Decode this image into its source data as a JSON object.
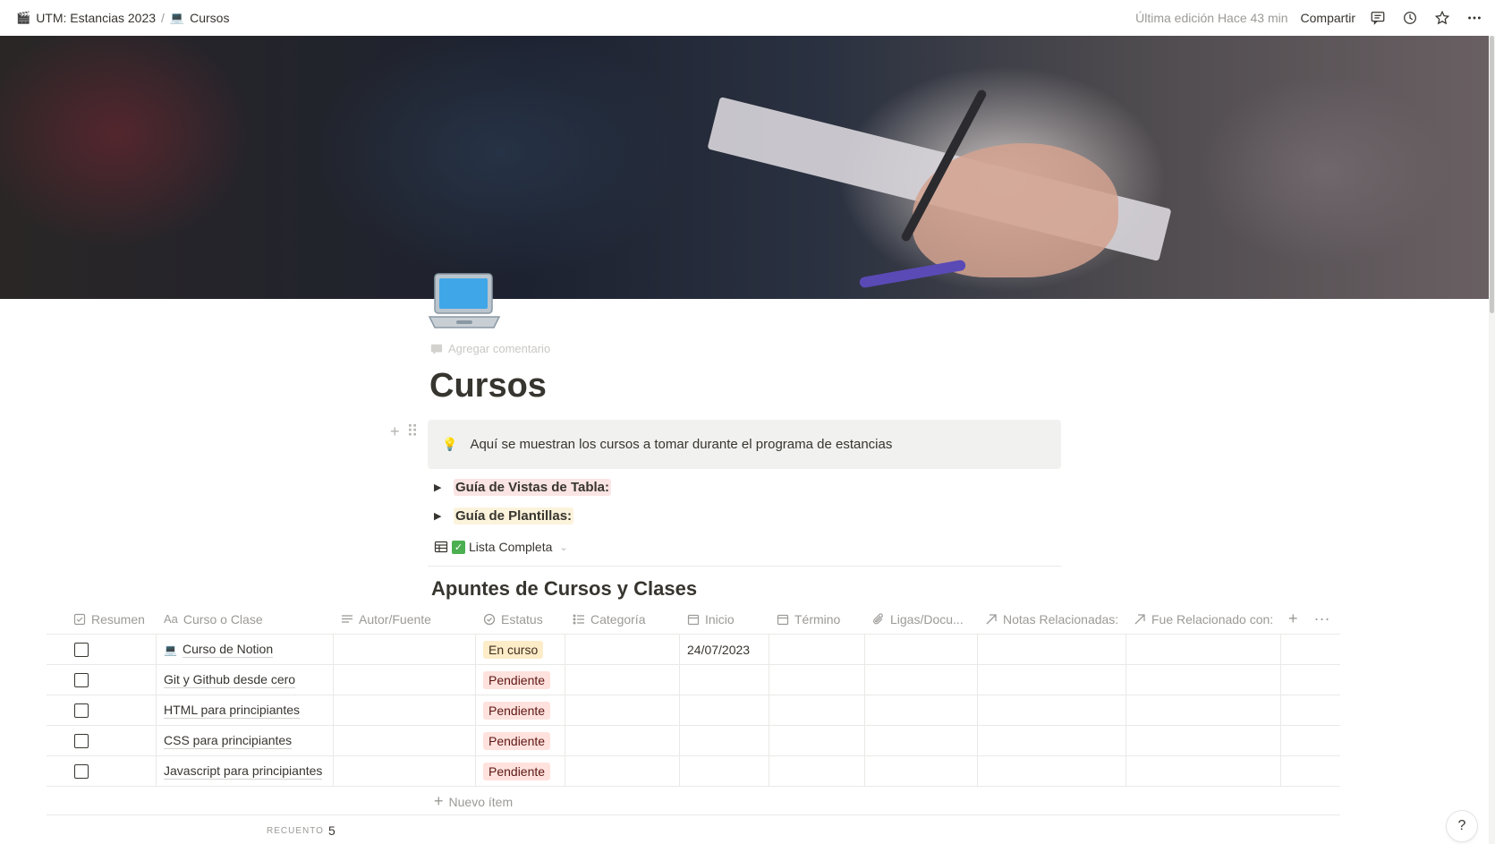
{
  "topbar": {
    "breadcrumbs": [
      {
        "emoji": "🎬",
        "label": "UTM: Estancias 2023"
      },
      {
        "emoji": "💻",
        "label": "Cursos"
      }
    ],
    "separator": "/",
    "edited": "Última edición Hace 43 min",
    "share": "Compartir",
    "icons": [
      "comments-icon",
      "history-icon",
      "star-icon",
      "more-icon"
    ]
  },
  "page": {
    "icon": "laptop-emoji",
    "add_comment": "Agregar comentario",
    "title": "Cursos",
    "callout": {
      "emoji": "💡",
      "text": "Aquí se muestran los cursos a tomar durante el programa de estancias"
    },
    "toggles": [
      {
        "label": "Guía de Vistas de Tabla:",
        "highlight": "#fbe4e4"
      },
      {
        "label": "Guía de Plantillas:",
        "highlight": "#fbf3db"
      }
    ],
    "view": {
      "check": "✓",
      "label": "Lista Completa"
    },
    "database_title": "Apuntes de Cursos y Clases"
  },
  "table": {
    "columns": [
      {
        "label": "Resumen",
        "icon": "checkbox-icon"
      },
      {
        "label": "Curso o Clase",
        "icon": "title-icon"
      },
      {
        "label": "Autor/Fuente",
        "icon": "text-icon"
      },
      {
        "label": "Estatus",
        "icon": "status-icon"
      },
      {
        "label": "Categoría",
        "icon": "list-icon"
      },
      {
        "label": "Inicio",
        "icon": "calendar-icon"
      },
      {
        "label": "Término",
        "icon": "calendar-icon"
      },
      {
        "label": "Ligas/Docu...",
        "icon": "paperclip-icon"
      },
      {
        "label": "Notas Relacionadas:",
        "icon": "relation-icon"
      },
      {
        "label": "Fue Relacionado con:",
        "icon": "relation-icon"
      }
    ],
    "rows": [
      {
        "checked": false,
        "emoji": "💻",
        "name": "Curso de Notion",
        "status": "En curso",
        "status_color": "#fdecc8",
        "start": "24/07/2023"
      },
      {
        "checked": false,
        "emoji": "",
        "name": "Git y Github desde cero",
        "status": "Pendiente",
        "status_color": "#ffe2dd",
        "start": ""
      },
      {
        "checked": false,
        "emoji": "",
        "name": "HTML para principiantes",
        "status": "Pendiente",
        "status_color": "#ffe2dd",
        "start": ""
      },
      {
        "checked": false,
        "emoji": "",
        "name": "CSS para principiantes",
        "status": "Pendiente",
        "status_color": "#ffe2dd",
        "start": ""
      },
      {
        "checked": false,
        "emoji": "",
        "name": "Javascript para principiantes",
        "status": "Pendiente",
        "status_color": "#ffe2dd",
        "start": ""
      }
    ],
    "new_item": "Nuevo ítem",
    "count_label": "RECUENTO",
    "count_value": "5"
  },
  "help": "?"
}
